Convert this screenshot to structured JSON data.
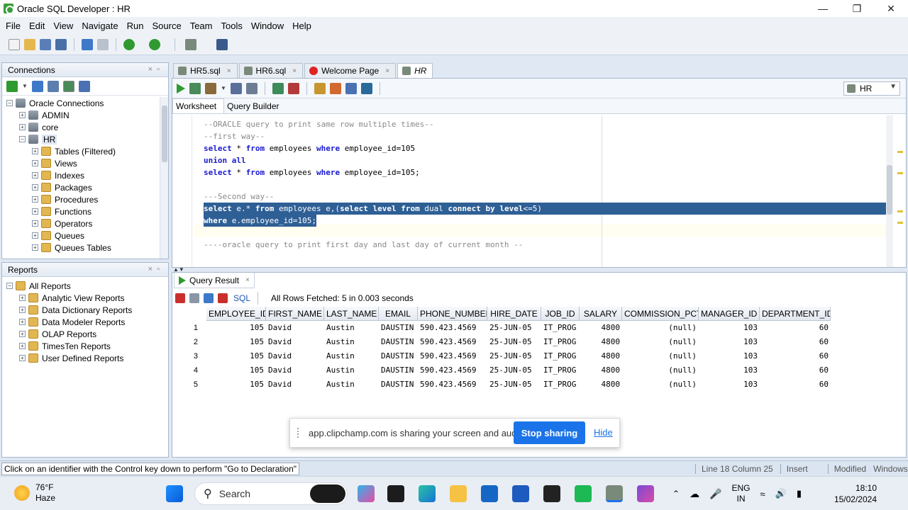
{
  "window": {
    "title": "Oracle SQL Developer : HR"
  },
  "menu": [
    "File",
    "Edit",
    "View",
    "Navigate",
    "Run",
    "Source",
    "Team",
    "Tools",
    "Window",
    "Help"
  ],
  "connections": {
    "header": "Connections",
    "items": [
      {
        "label": "Oracle Connections",
        "level": 0,
        "icon": "db"
      },
      {
        "label": "ADMIN",
        "level": 1,
        "icon": "db"
      },
      {
        "label": "core",
        "level": 1,
        "icon": "db"
      },
      {
        "label": "HR",
        "level": 1,
        "icon": "db"
      },
      {
        "label": "Tables (Filtered)",
        "level": 2,
        "icon": "folder"
      },
      {
        "label": "Views",
        "level": 2,
        "icon": "folder"
      },
      {
        "label": "Indexes",
        "level": 2,
        "icon": "folder"
      },
      {
        "label": "Packages",
        "level": 2,
        "icon": "folder"
      },
      {
        "label": "Procedures",
        "level": 2,
        "icon": "folder"
      },
      {
        "label": "Functions",
        "level": 2,
        "icon": "folder"
      },
      {
        "label": "Operators",
        "level": 2,
        "icon": "folder"
      },
      {
        "label": "Queues",
        "level": 2,
        "icon": "folder"
      },
      {
        "label": "Queues Tables",
        "level": 2,
        "icon": "folder"
      }
    ]
  },
  "reports": {
    "header": "Reports",
    "items": [
      {
        "label": "All Reports",
        "level": 0
      },
      {
        "label": "Analytic View Reports",
        "level": 1
      },
      {
        "label": "Data Dictionary Reports",
        "level": 1
      },
      {
        "label": "Data Modeler Reports",
        "level": 1
      },
      {
        "label": "OLAP Reports",
        "level": 1
      },
      {
        "label": "TimesTen Reports",
        "level": 1
      },
      {
        "label": "User Defined Reports",
        "level": 1
      }
    ]
  },
  "tabs": [
    {
      "label": "HR5.sql",
      "active": false
    },
    {
      "label": "HR6.sql",
      "active": false
    },
    {
      "label": "Welcome Page",
      "active": false
    },
    {
      "label": "HR",
      "active": true
    }
  ],
  "editor": {
    "connection": "HR",
    "subtabs": [
      "Worksheet",
      "Query Builder"
    ],
    "lines": [
      {
        "text": "--ORACLE query to print same row multiple times--",
        "type": "comment"
      },
      {
        "text": "--first way--",
        "type": "comment"
      },
      {
        "text": "select * from employees where employee_id=105",
        "type": "code"
      },
      {
        "text": "union all",
        "type": "code"
      },
      {
        "text": "select * from employees where employee_id=105;",
        "type": "code"
      },
      {
        "text": "",
        "type": "blank"
      },
      {
        "text": "---Second way--",
        "type": "comment"
      },
      {
        "text": "select e.* from employees e,(select level from dual connect by level<=5)",
        "type": "selected"
      },
      {
        "text": "where e.employee_id=105;",
        "type": "selected"
      },
      {
        "text": "",
        "type": "blank"
      },
      {
        "text": "----oracle query to print first day and last day of current month --",
        "type": "comment"
      }
    ],
    "keywords": [
      "select",
      "from",
      "where",
      "union",
      "all",
      "level",
      "connect",
      "by"
    ]
  },
  "result": {
    "tab_label": "Query Result",
    "sql_label": "SQL",
    "status": "All Rows Fetched: 5 in 0.003 seconds",
    "columns": [
      "EMPLOYEE_ID",
      "FIRST_NAME",
      "LAST_NAME",
      "EMAIL",
      "PHONE_NUMBER",
      "HIRE_DATE",
      "JOB_ID",
      "SALARY",
      "COMMISSION_PCT",
      "MANAGER_ID",
      "DEPARTMENT_ID"
    ],
    "rows": [
      [
        "1",
        "105",
        "David",
        "Austin",
        "DAUSTIN",
        "590.423.4569",
        "25-JUN-05",
        "IT_PROG",
        "4800",
        "(null)",
        "103",
        "60"
      ],
      [
        "2",
        "105",
        "David",
        "Austin",
        "DAUSTIN",
        "590.423.4569",
        "25-JUN-05",
        "IT_PROG",
        "4800",
        "(null)",
        "103",
        "60"
      ],
      [
        "3",
        "105",
        "David",
        "Austin",
        "DAUSTIN",
        "590.423.4569",
        "25-JUN-05",
        "IT_PROG",
        "4800",
        "(null)",
        "103",
        "60"
      ],
      [
        "4",
        "105",
        "David",
        "Austin",
        "DAUSTIN",
        "590.423.4569",
        "25-JUN-05",
        "IT_PROG",
        "4800",
        "(null)",
        "103",
        "60"
      ],
      [
        "5",
        "105",
        "David",
        "Austin",
        "DAUSTIN",
        "590.423.4569",
        "25-JUN-05",
        "IT_PROG",
        "4800",
        "(null)",
        "103",
        "60"
      ]
    ]
  },
  "share_banner": {
    "message": "app.clipchamp.com is sharing your screen and audio.",
    "stop_label": "Stop sharing",
    "hide_label": "Hide"
  },
  "statusbar": {
    "hint": "Click on an identifier with the Control key down to perform \"Go to Declaration\"",
    "position": "Line 18 Column 25",
    "mode": "Insert",
    "state": "Modified",
    "eol": "Windows: CR"
  },
  "taskbar": {
    "weather_temp": "76°F",
    "weather_desc": "Haze",
    "search_placeholder": "Search",
    "lang_top": "ENG",
    "lang_bottom": "IN",
    "time": "18:10",
    "date": "15/02/2024"
  },
  "colors": {
    "selection": "#2e5f95",
    "keyword": "#1a1ad0",
    "accent": "#1a73e8",
    "run_green": "#2f9a2f"
  }
}
